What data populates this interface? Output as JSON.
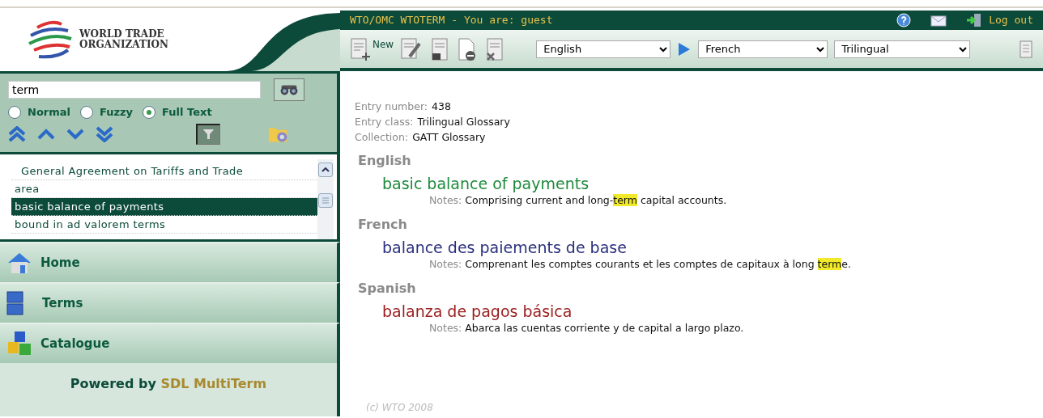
{
  "logo": {
    "line1": "WORLD TRADE",
    "line2": "ORGANIZATION"
  },
  "header": {
    "title": "WTO/OMC WTOTERM - You are: guest",
    "logout": "Log out"
  },
  "toolbar": {
    "new_label": "New",
    "source_language": "English",
    "target_language": "French",
    "layout": "Trilingual"
  },
  "search": {
    "value": "term",
    "filter_active": true,
    "modes": [
      {
        "label": "Normal",
        "selected": false
      },
      {
        "label": "Fuzzy",
        "selected": false
      },
      {
        "label": "Full Text",
        "selected": true
      }
    ]
  },
  "results": [
    {
      "label": "General Agreement on Tariffs and Trade",
      "selected": false
    },
    {
      "label": "area",
      "selected": false
    },
    {
      "label": "basic balance of payments",
      "selected": true
    },
    {
      "label": "bound in ad valorem terms",
      "selected": false
    }
  ],
  "nav": [
    {
      "label": "Home",
      "kind": "home"
    },
    {
      "label": "Terms",
      "kind": "terms"
    },
    {
      "label": "Catalogue",
      "kind": "catalogue"
    }
  ],
  "powered": {
    "prefix": "Powered by",
    "brand": "SDL MultiTerm"
  },
  "entry": {
    "fields": [
      {
        "label": "Entry number:",
        "value": "438"
      },
      {
        "label": "Entry class:",
        "value": "Trilingual Glossary"
      },
      {
        "label": "Collection:",
        "value": "GATT Glossary"
      }
    ],
    "languages": [
      {
        "name": "English",
        "term": "basic balance of payments",
        "color": "#1e8a3c",
        "notes_label": "Notes:",
        "notes": [
          {
            "text": "Comprising current and long-",
            "highlighted": false
          },
          {
            "text": "term",
            "highlighted": true
          },
          {
            "text": " capital accounts.",
            "highlighted": false
          }
        ]
      },
      {
        "name": "French",
        "term": "balance des paiements de base",
        "color": "#2a2f7c",
        "notes_label": "Notes:",
        "notes": [
          {
            "text": "Comprenant les comptes courants et les comptes de capitaux à long ",
            "highlighted": false
          },
          {
            "text": "term",
            "highlighted": true
          },
          {
            "text": "e.",
            "highlighted": false
          }
        ]
      },
      {
        "name": "Spanish",
        "term": "balanza de pagos básica",
        "color": "#9a1c1c",
        "notes_label": "Notes:",
        "notes": [
          {
            "text": "Abarca las cuentas corriente y de capital a largo plazo.",
            "highlighted": false
          }
        ]
      }
    ]
  },
  "copyright": "(c) WTO 2008"
}
